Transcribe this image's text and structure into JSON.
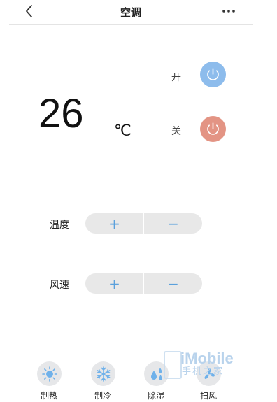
{
  "header": {
    "title": "空调",
    "back_icon": "chevron-left-icon",
    "more_icon": "more-horizontal-icon"
  },
  "temperature": {
    "value": "26",
    "unit": "℃"
  },
  "power": {
    "on_label": "开",
    "off_label": "关",
    "on_color": "#8dbcec",
    "off_color": "#e39484",
    "icon": "power-icon"
  },
  "controls": {
    "temperature_label": "温度",
    "wind_label": "风速",
    "plus": "+",
    "minus": "−"
  },
  "modes": [
    {
      "label": "制热",
      "icon": "sun-icon"
    },
    {
      "label": "制冷",
      "icon": "snowflake-icon"
    },
    {
      "label": "除湿",
      "icon": "water-drops-icon"
    },
    {
      "label": "扫风",
      "icon": "fan-icon"
    }
  ],
  "watermark": {
    "brand": "iMobile",
    "sub": "手机之家"
  },
  "colors": {
    "accent": "#5aa0dc",
    "mode_icon": "#6fb1ea"
  }
}
